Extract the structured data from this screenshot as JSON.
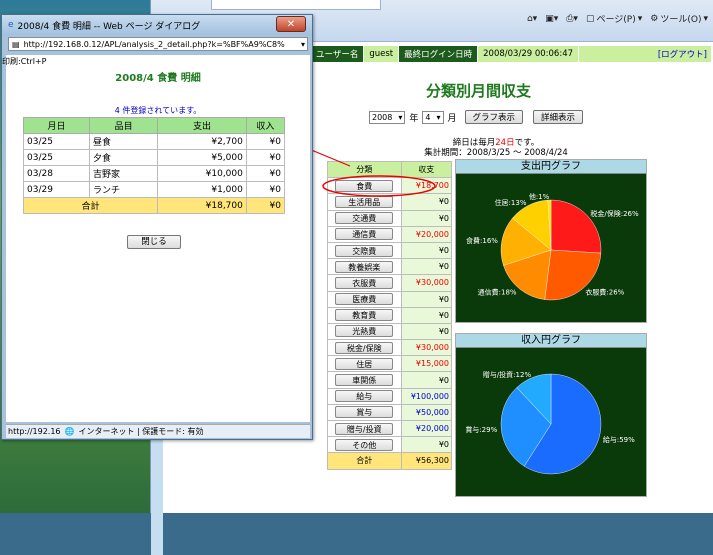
{
  "browser": {
    "page_menu": "ページ(P)",
    "tools_menu": "ツール(O)"
  },
  "header": {
    "user_label": "ユーザー名",
    "user_value": "guest",
    "last_login_label": "最終ログイン日時",
    "last_login_value": "2008/03/29 00:06:47",
    "logout": "[ログアウト]"
  },
  "main": {
    "title": "分類別月間収支",
    "year_value": "2008",
    "year_suffix": "年",
    "month_value": "4",
    "month_suffix": "月",
    "graph_button": "グラフ表示",
    "detail_button": "詳細表示",
    "closing_pre": "締日は毎月",
    "closing_day": "24日",
    "closing_post": "です。",
    "period": "集計期間：2008/3/25 ～ 2008/4/24"
  },
  "category_table": {
    "headers": [
      "分類",
      "収支"
    ],
    "rows": [
      {
        "label": "食費",
        "value": "¥18,700",
        "color": "red"
      },
      {
        "label": "生活用品",
        "value": "¥0",
        "color": "black"
      },
      {
        "label": "交通費",
        "value": "¥0",
        "color": "black"
      },
      {
        "label": "通信費",
        "value": "¥20,000",
        "color": "red"
      },
      {
        "label": "交際費",
        "value": "¥0",
        "color": "black"
      },
      {
        "label": "教養娯楽",
        "value": "¥0",
        "color": "black"
      },
      {
        "label": "衣服費",
        "value": "¥30,000",
        "color": "red"
      },
      {
        "label": "医療費",
        "value": "¥0",
        "color": "black"
      },
      {
        "label": "教育費",
        "value": "¥0",
        "color": "black"
      },
      {
        "label": "光熱費",
        "value": "¥0",
        "color": "black"
      },
      {
        "label": "税金/保険",
        "value": "¥30,000",
        "color": "red"
      },
      {
        "label": "住居",
        "value": "¥15,000",
        "color": "red"
      },
      {
        "label": "車関係",
        "value": "¥0",
        "color": "black"
      },
      {
        "label": "給与",
        "value": "¥100,000",
        "color": "blue"
      },
      {
        "label": "賞与",
        "value": "¥50,000",
        "color": "blue"
      },
      {
        "label": "贈与/投資",
        "value": "¥20,000",
        "color": "blue"
      },
      {
        "label": "その他",
        "value": "¥0",
        "color": "black"
      }
    ],
    "total_label": "合計",
    "total_value": "¥56,300"
  },
  "expense_graph": {
    "title": "支出円グラフ",
    "slices": [
      {
        "label": "税金/保険:26%",
        "pct": 26,
        "color": "#ff1a1a"
      },
      {
        "label": "衣服費:26%",
        "pct": 26,
        "color": "#ff5a00"
      },
      {
        "label": "通信費:18%",
        "pct": 18,
        "color": "#ff8c00"
      },
      {
        "label": "食費:16%",
        "pct": 16,
        "color": "#ffb000"
      },
      {
        "label": "住居:13%",
        "pct": 13,
        "color": "#ffd000"
      },
      {
        "label": "他:1%",
        "pct": 1,
        "color": "#ffe600"
      }
    ]
  },
  "income_graph": {
    "title": "収入円グラフ",
    "slices": [
      {
        "label": "給与:59%",
        "pct": 59,
        "color": "#1a6cff"
      },
      {
        "label": "賞与:29%",
        "pct": 29,
        "color": "#1f8fff"
      },
      {
        "label": "贈与/投資:12%",
        "pct": 12,
        "color": "#22aaff"
      }
    ]
  },
  "popup": {
    "window_title": "2008/4 食費 明細 -- Web ページ ダイアログ",
    "address": "http://192.168.0.12/APL/analysis_2_detail.php?k=%BF%A9%C8%",
    "print_hint": "印刷:Ctrl+P",
    "title": "2008/4 食費 明細",
    "note": "4 件登録されています。",
    "headers": [
      "月日",
      "品目",
      "支出",
      "収入"
    ],
    "rows": [
      {
        "date": "03/25",
        "item": "昼食",
        "expense": "¥2,700",
        "income": "¥0"
      },
      {
        "date": "03/25",
        "item": "夕食",
        "expense": "¥5,000",
        "income": "¥0"
      },
      {
        "date": "03/28",
        "item": "吉野家",
        "expense": "¥10,000",
        "income": "¥0"
      },
      {
        "date": "03/29",
        "item": "ランチ",
        "expense": "¥1,000",
        "income": "¥0"
      }
    ],
    "total_label": "合計",
    "total_expense": "¥18,700",
    "total_income": "¥0",
    "close_button": "閉じる",
    "status_url": "http://192.16",
    "status_zone": "インターネット | 保護モード: 有効"
  }
}
